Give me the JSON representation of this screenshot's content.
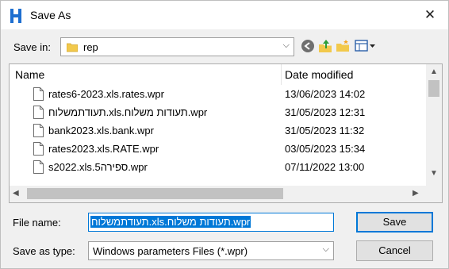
{
  "window": {
    "title": "Save As",
    "close_glyph": "✕"
  },
  "toolbar": {
    "save_in_label": "Save in:",
    "folder": "rep",
    "icons": [
      "back-icon",
      "up-folder-icon",
      "new-folder-icon",
      "view-menu-icon"
    ]
  },
  "list": {
    "columns": {
      "name": "Name",
      "date": "Date modified"
    },
    "rows": [
      {
        "name": "rates6-2023.xls.rates.wpr",
        "date": "13/06/2023 14:02"
      },
      {
        "name": "תעודתמשלוח.xls.תעודות משלוח.wpr",
        "date": "31/05/2023 12:31"
      },
      {
        "name": "bank2023.xls.bank.wpr",
        "date": "31/05/2023 11:32"
      },
      {
        "name": "rates2023.xls.RATE.wpr",
        "date": "03/05/2023 15:34"
      },
      {
        "name": "s2022.xls.5ספירה.wpr",
        "date": "07/11/2022 13:00"
      }
    ]
  },
  "form": {
    "file_name_label": "File name:",
    "file_name_value": "תעודתמשלוח.xls.תעודות משלוח.wpr",
    "save_as_type_label": "Save as type:",
    "save_as_type_value": "Windows parameters Files (*.wpr)"
  },
  "buttons": {
    "save": "Save",
    "cancel": "Cancel"
  },
  "colors": {
    "accent": "#0078d7",
    "app_icon": "#1e6fd0"
  }
}
